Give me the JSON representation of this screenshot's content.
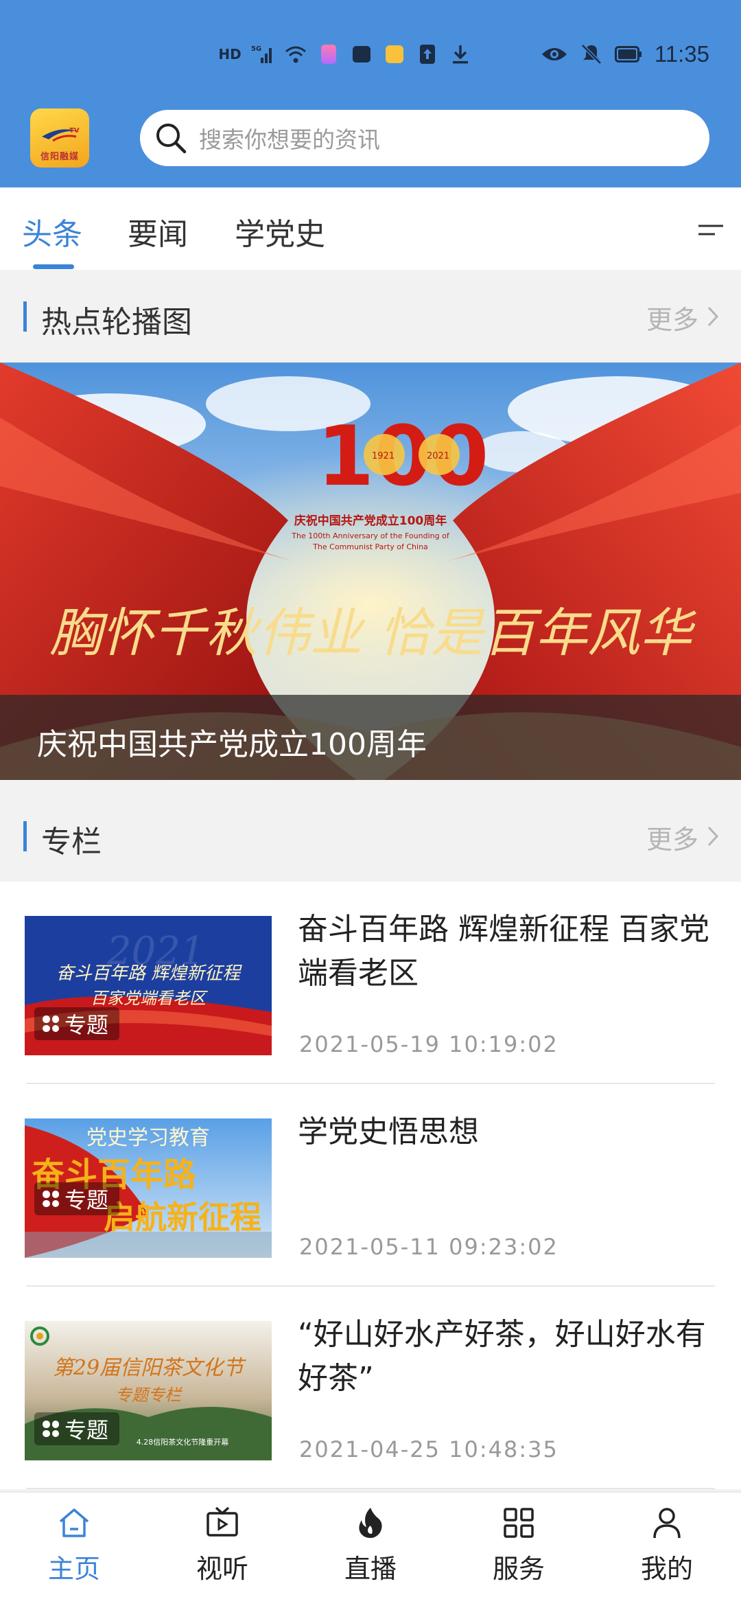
{
  "status_bar": {
    "left_icons": [
      "hd-icon",
      "5g-signal-icon",
      "wifi-icon",
      "app-notification-icon",
      "huawei-icon",
      "app-icon",
      "upload-icon",
      "download-icon"
    ],
    "right_icons": [
      "eye-icon",
      "mute-icon",
      "battery-icon"
    ],
    "time": "11:35"
  },
  "header": {
    "logo_text": "信阳融媒",
    "search_placeholder": "搜索你想要的资讯"
  },
  "tabs": [
    {
      "label": "头条",
      "active": true
    },
    {
      "label": "要闻",
      "active": false
    },
    {
      "label": "学党史",
      "active": false
    }
  ],
  "hot_section": {
    "title": "热点轮播图",
    "more": "更多"
  },
  "banner": {
    "emblem_text": "100",
    "year_start": "1921",
    "year_end": "2021",
    "subtitle_cn": "庆祝中国共产党成立100周年",
    "subtitle_en_1": "The 100th Anniversary of the Founding of",
    "subtitle_en_2": "The Communist Party of China",
    "calligraphy": "胸怀千秋伟业 恰是百年风华",
    "caption": "庆祝中国共产党成立100周年"
  },
  "column_section": {
    "title": "专栏",
    "more": "更多"
  },
  "articles": [
    {
      "title": "奋斗百年路  辉煌新征程  百家党端看老区",
      "date": "2021-05-19  10:19:02",
      "tag": "专题",
      "thumb_lines": [
        "奋斗百年路 辉煌新征程",
        "百家党端看老区"
      ],
      "thumb_year": "2021"
    },
    {
      "title": "学党史悟思想",
      "date": "2021-05-11  09:23:02",
      "tag": "专题",
      "thumb_lines": [
        "党史学习教育",
        "奋斗百年路",
        "启航新征程"
      ]
    },
    {
      "title": "“好山好水产好茶，好山好水有好茶”",
      "date": "2021-04-25  10:48:35",
      "tag": "专题",
      "thumb_lines": [
        "第29届信阳茶文化节",
        "专题专栏",
        "4.28信阳茶文化节隆重开幕"
      ]
    }
  ],
  "bottom_nav": [
    {
      "label": "主页",
      "icon": "home-icon",
      "active": true
    },
    {
      "label": "视听",
      "icon": "video-icon",
      "active": false
    },
    {
      "label": "直播",
      "icon": "flame-icon",
      "active": false
    },
    {
      "label": "服务",
      "icon": "grid-icon",
      "active": false
    },
    {
      "label": "我的",
      "icon": "user-icon",
      "active": false
    }
  ],
  "colors": {
    "accent": "#3a84d8",
    "header_bg": "#4a8fdc"
  }
}
